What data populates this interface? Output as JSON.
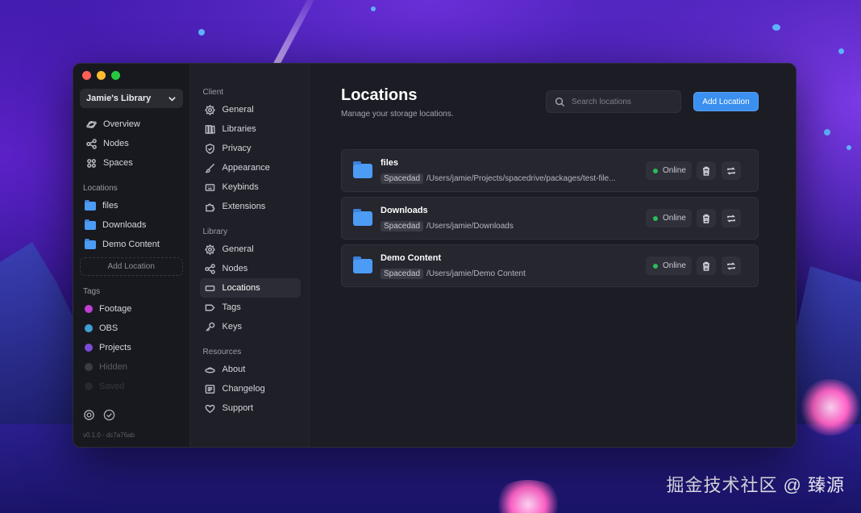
{
  "sidebar": {
    "library_name": "Jamie's Library",
    "nav": [
      {
        "label": "Overview",
        "icon": "planet-icon"
      },
      {
        "label": "Nodes",
        "icon": "share-icon"
      },
      {
        "label": "Spaces",
        "icon": "grid-icon"
      }
    ],
    "locations_heading": "Locations",
    "locations": [
      "files",
      "Downloads",
      "Demo Content"
    ],
    "add_location_label": "Add Location",
    "tags_heading": "Tags",
    "tags": [
      {
        "label": "Footage",
        "color": "#c13fd3"
      },
      {
        "label": "OBS",
        "color": "#3f9fd3"
      },
      {
        "label": "Projects",
        "color": "#7b4bd8"
      },
      {
        "label": "Hidden",
        "color": "#3a3b45"
      },
      {
        "label": "Saved",
        "color": "#3a3b45"
      }
    ],
    "version": "v0.1.0 - dc7a76ab"
  },
  "settings_nav": {
    "client_heading": "Client",
    "client_items": [
      "General",
      "Libraries",
      "Privacy",
      "Appearance",
      "Keybinds",
      "Extensions"
    ],
    "library_heading": "Library",
    "library_items": [
      "General",
      "Nodes",
      "Locations",
      "Tags",
      "Keys"
    ],
    "resources_heading": "Resources",
    "resources_items": [
      "About",
      "Changelog",
      "Support"
    ]
  },
  "main": {
    "title": "Locations",
    "subtitle": "Manage your storage locations.",
    "search_placeholder": "Search locations",
    "add_button": "Add Location",
    "locations": [
      {
        "name": "files",
        "node": "Spacedad",
        "path": "/Users/jamie/Projects/spacedrive/packages/test-file...",
        "status": "Online"
      },
      {
        "name": "Downloads",
        "node": "Spacedad",
        "path": "/Users/jamie/Downloads",
        "status": "Online"
      },
      {
        "name": "Demo Content",
        "node": "Spacedad",
        "path": "/Users/jamie/Demo Content",
        "status": "Online"
      }
    ]
  },
  "watermark": "掘金技术社区 @ 臻源",
  "colors": {
    "accent": "#3a8fef",
    "folder": "#4c9bf5",
    "online": "#2dbb5a",
    "traffic_close": "#ff5f57",
    "traffic_min": "#febc2e",
    "traffic_max": "#28c840"
  }
}
